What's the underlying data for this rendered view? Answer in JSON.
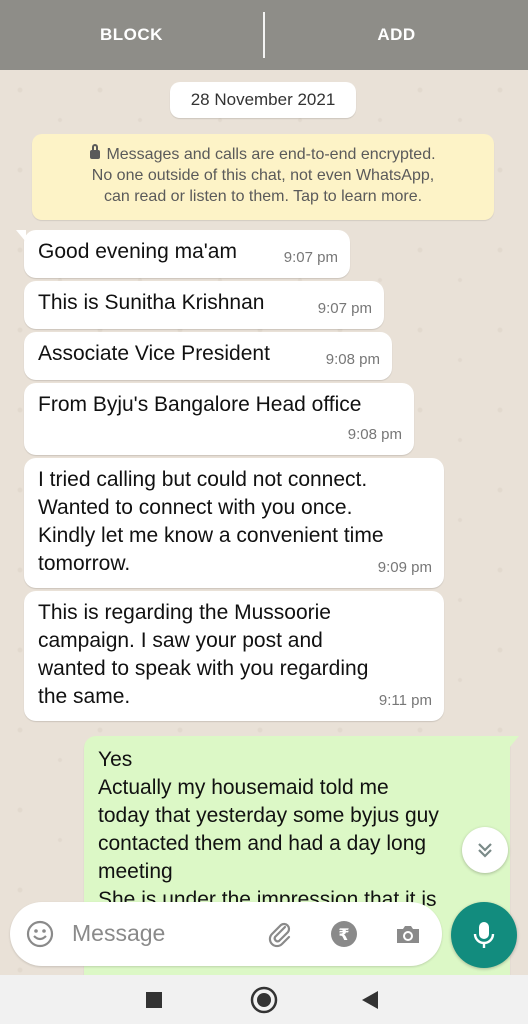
{
  "top_actions": {
    "block_label": "BLOCK",
    "add_label": "ADD"
  },
  "date_chip": "28 November 2021",
  "encryption_notice": {
    "line1": "Messages and calls are end-to-end encrypted.",
    "line2": "No one outside of this chat, not even WhatsApp,",
    "line3": "can read or listen to them. Tap to learn more."
  },
  "messages": [
    {
      "text": "Good evening ma'am",
      "time": "9:07 pm"
    },
    {
      "text": "This is Sunitha Krishnan",
      "time": "9:07 pm"
    },
    {
      "text": "Associate Vice President",
      "time": "9:08 pm"
    },
    {
      "text": "From Byju's Bangalore  Head office",
      "time": "9:08 pm"
    },
    {
      "lines": [
        "I tried calling  but could  not connect.",
        "Wanted to connect with you once.",
        "Kindly let me know a convenient time",
        "tomorrow."
      ],
      "time": "9:09 pm"
    },
    {
      "lines": [
        "This is regarding the Mussoorie",
        "campaign.  I saw your post and",
        "wanted  to speak with you regarding",
        "the same."
      ],
      "time": "9:11 pm"
    }
  ],
  "outgoing": {
    "lines": [
      "Yes",
      "Actually my housemaid told me",
      "today that yesterday some byjus guy",
      "contacted them and had a day long",
      "meeting",
      "She is under the impression that it is"
    ]
  },
  "composer": {
    "placeholder": "Message"
  },
  "colors": {
    "accent": "#128C7E",
    "outgoing_bubble": "#DCF8C6",
    "notice_bg": "#FDF3C7",
    "topbar": "#8E8D88"
  },
  "icons": [
    "emoji-icon",
    "attach-icon",
    "rupee-icon",
    "camera-icon",
    "mic-icon",
    "chevron-down-icon",
    "nav-recents-icon",
    "nav-home-icon",
    "nav-back-icon"
  ]
}
